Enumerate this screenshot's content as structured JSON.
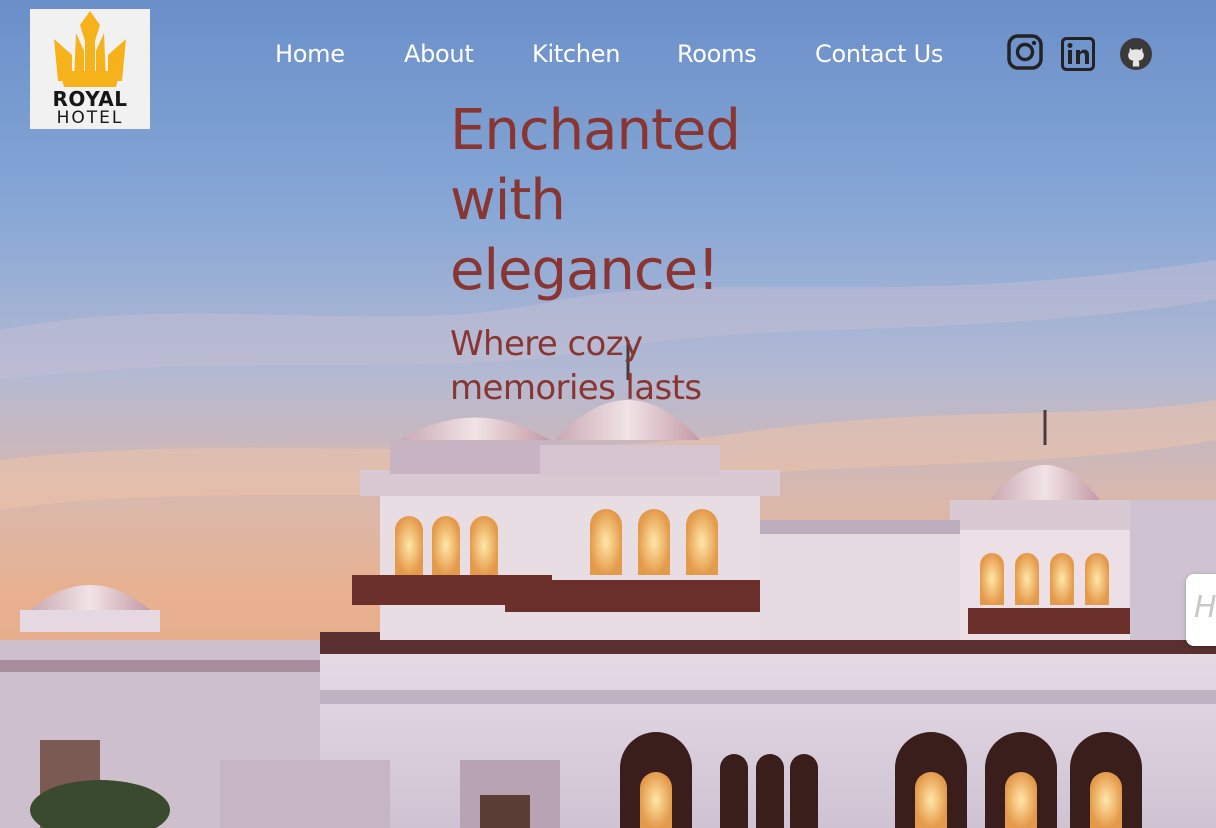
{
  "logo": {
    "line1": "ROYAL",
    "line2": "HOTEL",
    "brand_color": "#f5b21b"
  },
  "nav": {
    "items": [
      {
        "label": "Home"
      },
      {
        "label": "About"
      },
      {
        "label": "Kitchen"
      },
      {
        "label": "Rooms"
      },
      {
        "label": "Contact Us"
      }
    ]
  },
  "social": {
    "icons": [
      "instagram-icon",
      "linkedin-icon",
      "github-icon"
    ],
    "color": "#232323"
  },
  "hero": {
    "headline": "Enchanted with elegance!",
    "subheadline": "Where cozy memories lasts",
    "text_color": "#893632"
  },
  "side_widget": {
    "glyph": "H"
  }
}
